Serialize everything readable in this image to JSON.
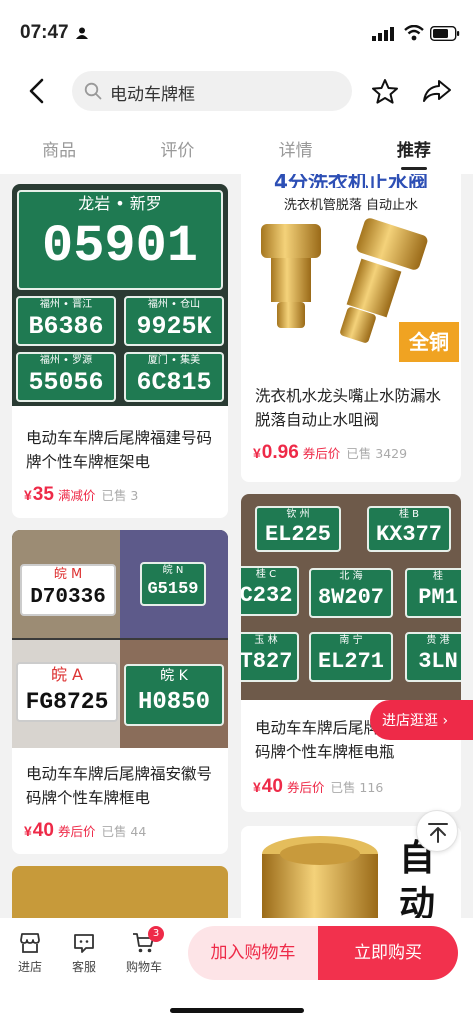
{
  "status_bar": {
    "time": "07:47"
  },
  "search": {
    "query": "电动车牌框"
  },
  "tabs": [
    {
      "label": "商品",
      "active": false
    },
    {
      "label": "评价",
      "active": false
    },
    {
      "label": "详情",
      "active": false
    },
    {
      "label": "推荐",
      "active": true
    }
  ],
  "cards": [
    {
      "title": "电动车车牌后尾牌福建号码牌个性车牌框架电",
      "price": "35",
      "tag": "满减价",
      "sold": "已售 3",
      "plates": [
        {
          "top": "龙岩 • 新罗",
          "num": "05901"
        },
        {
          "top": "福州 • 晋江",
          "num": "B6386"
        },
        {
          "top": "福州 • 仓山",
          "num": "9925K"
        },
        {
          "top": "福州 • 罗源",
          "num": "55056"
        },
        {
          "top": "厦门 • 集美",
          "num": "6C815"
        }
      ]
    },
    {
      "title": "电动车车牌后尾牌福安徽号码牌个性车牌框电",
      "price": "40",
      "tag": "券后价",
      "sold": "已售 44",
      "plates": [
        {
          "top": "皖 M",
          "num": "D70336"
        },
        {
          "top": "皖 N",
          "num": "G5159"
        },
        {
          "top": "皖 A",
          "num": "FG8725"
        },
        {
          "top": "皖 K",
          "num": "H0850"
        }
      ]
    },
    {
      "banner": "4分洗衣机止水阀",
      "subtitle": "洗衣机管脱落 自动止水",
      "badge": "全铜",
      "title": "洗衣机水龙头嘴止水防漏水脱落自动止水咀阀",
      "price": "0.96",
      "tag": "券后价",
      "sold": "已售 3429"
    },
    {
      "title": "电动车车牌后尾牌福广西号码牌个性车牌框电瓶",
      "price": "40",
      "tag": "券后价",
      "sold": "已售 116",
      "plates": [
        {
          "top": "钦 州",
          "num": "EL225"
        },
        {
          "top": "桂 B",
          "num": "KX377"
        },
        {
          "top": "桂 C",
          "num": "C232"
        },
        {
          "top": "北 海",
          "num": "8W207"
        },
        {
          "top": "桂",
          "num": "PM1"
        },
        {
          "top": "玉 林",
          "num": "T827"
        },
        {
          "top": "南 宁",
          "num": "EL271"
        },
        {
          "top": "贵 港",
          "num": "3LN"
        }
      ]
    },
    {
      "banner": "自动"
    }
  ],
  "float": {
    "store_label": "进店逛逛"
  },
  "bottom_bar": {
    "store": "进店",
    "service": "客服",
    "cart": "购物车",
    "cart_count": "3",
    "add_to_cart": "加入购物车",
    "buy_now": "立即购买"
  },
  "colors": {
    "accent": "#ee2a48",
    "plate_green": "#1f7a52",
    "gold": "#d8a93a"
  }
}
